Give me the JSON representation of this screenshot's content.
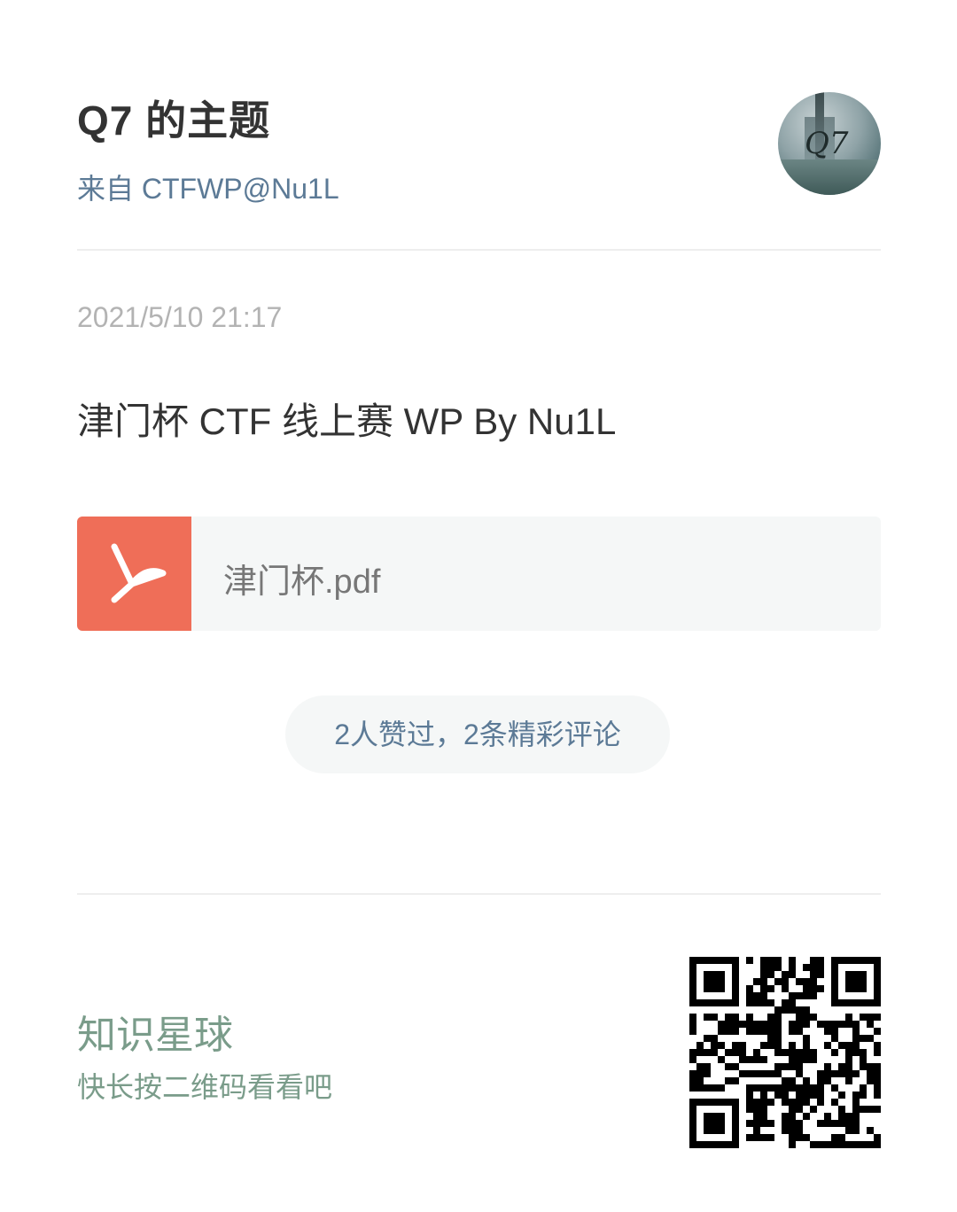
{
  "topic": {
    "title": "Q7 的主题",
    "source": "来自 CTFWP@Nu1L",
    "avatar_text": "Q7"
  },
  "post": {
    "timestamp": "2021/5/10 21:17",
    "text": "津门杯 CTF 线上赛 WP By Nu1L",
    "attachment": {
      "file_name": "津门杯.pdf",
      "icon": "pdf-icon",
      "icon_color": "#ef6e58"
    },
    "reactions": "2人赞过，2条精彩评论"
  },
  "footer": {
    "brand": "知识星球",
    "cta": "快长按二维码看看吧",
    "qr_icon": "qr-code"
  },
  "colors": {
    "accent_blue": "#5c7a96",
    "brand_green": "#7a9c8a",
    "pdf_red": "#ef6e58"
  }
}
